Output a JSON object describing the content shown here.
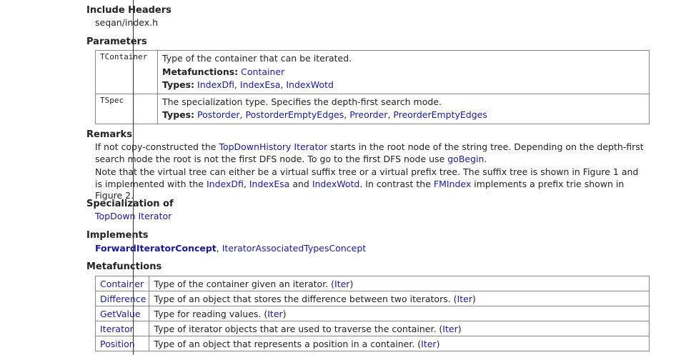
{
  "include_headers": {
    "title": "Include Headers",
    "file": "seqan/index.h"
  },
  "parameters": {
    "title": "Parameters",
    "rows": [
      {
        "name": "TContainer",
        "description": "Type of the container that can be iterated.",
        "metafunctions_label": "Metafunctions:",
        "metafunctions": [
          "Container"
        ],
        "types_label": "Types:",
        "types": [
          "IndexDfi",
          "IndexEsa",
          "IndexWotd"
        ]
      },
      {
        "name": "TSpec",
        "description": "The specialization type. Specifies the depth-first search mode.",
        "types_label": "Types:",
        "types": [
          "Postorder",
          "PostorderEmptyEdges",
          "Preorder",
          "PreorderEmptyEdges"
        ]
      }
    ]
  },
  "remarks": {
    "title": "Remarks",
    "p1_a": "If not copy-constructed the ",
    "p1_link1": "TopDownHistory Iterator",
    "p1_b": " starts in the root node of the string tree. Depending on the depth-first search mode the root is not the first DFS node. To go to the first DFS node use ",
    "p1_link2": "goBegin",
    "p1_c": ".",
    "p2_a": "Note that the virtual tree can either be a virtual suffix tree or a virtual prefix tree. The suffix tree is shown in Figure 1 and is implemented with the ",
    "p2_link1": "IndexDfi",
    "p2_sep1": ", ",
    "p2_link2": "IndexEsa",
    "p2_and": " and ",
    "p2_link3": "IndexWotd",
    "p2_b": ". In contrast the ",
    "p2_link4": "FMIndex",
    "p2_c": " implements a prefix trie shown in Figure 2."
  },
  "specialization": {
    "title": "Specialization of",
    "link": "TopDown Iterator"
  },
  "implements": {
    "title": "Implements",
    "link1": "ForwardIteratorConcept",
    "sep": ", ",
    "link2": "IteratorAssociatedTypesConcept"
  },
  "metafunctions": {
    "title": "Metafunctions",
    "rows": [
      {
        "name": "Container",
        "description": "Type of the container given an iterator. (",
        "ref": "Iter",
        "close": ")"
      },
      {
        "name": "Difference",
        "description": "Type of an object that stores the difference between two iterators. (",
        "ref": "Iter",
        "close": ")"
      },
      {
        "name": "GetValue",
        "description": "Type for reading values. (",
        "ref": "Iter",
        "close": ")"
      },
      {
        "name": "Iterator",
        "description": "Type of iterator objects that are used to traverse the container. (",
        "ref": "Iter",
        "close": ")"
      },
      {
        "name": "Position",
        "description": "Type of an object that represents a position in a container. (",
        "ref": "Iter",
        "close": ")"
      }
    ]
  }
}
